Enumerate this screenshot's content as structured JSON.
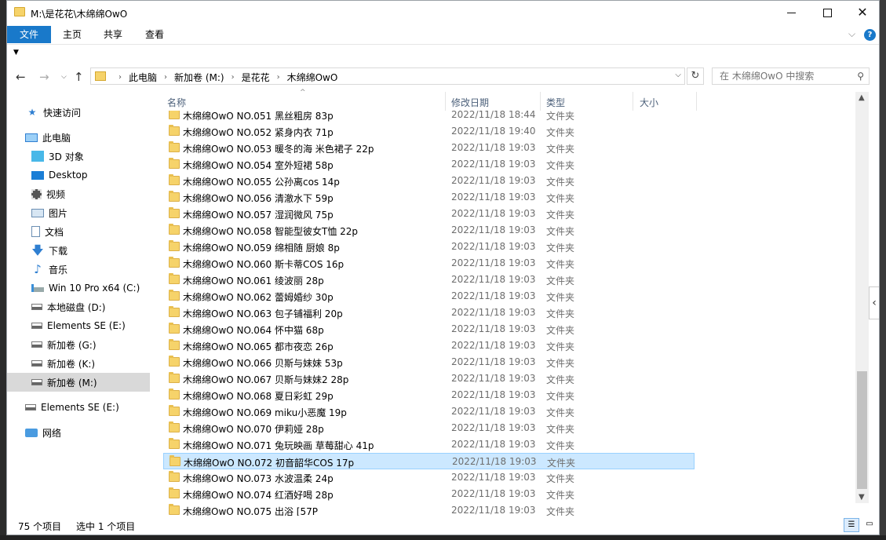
{
  "window": {
    "title": "M:\\是花花\\木绵绵OwO"
  },
  "ribbon": {
    "tabs": [
      "文件",
      "主页",
      "共享",
      "查看"
    ]
  },
  "address": {
    "crumbs": [
      "此电脑",
      "新加卷 (M:)",
      "是花花",
      "木绵绵OwO"
    ],
    "search_placeholder": "在 木绵绵OwO 中搜索"
  },
  "nav": {
    "items": [
      {
        "label": "快速访问",
        "icon": "star-icon"
      },
      {
        "label": "此电脑",
        "icon": "computer-icon"
      },
      {
        "label": "3D 对象",
        "icon": "3d-objects-icon"
      },
      {
        "label": "Desktop",
        "icon": "desktop-icon"
      },
      {
        "label": "视频",
        "icon": "video-icon"
      },
      {
        "label": "图片",
        "icon": "pictures-icon"
      },
      {
        "label": "文档",
        "icon": "documents-icon"
      },
      {
        "label": "下载",
        "icon": "download-icon"
      },
      {
        "label": "音乐",
        "icon": "music-icon"
      },
      {
        "label": "Win 10 Pro x64 (C:)",
        "icon": "windows-drive-icon"
      },
      {
        "label": "本地磁盘 (D:)",
        "icon": "drive-icon"
      },
      {
        "label": "Elements SE (E:)",
        "icon": "drive-icon"
      },
      {
        "label": "新加卷 (G:)",
        "icon": "drive-icon"
      },
      {
        "label": "新加卷 (K:)",
        "icon": "drive-icon"
      },
      {
        "label": "新加卷 (M:)",
        "icon": "drive-icon"
      },
      {
        "label": "Elements SE (E:)",
        "icon": "drive-icon"
      },
      {
        "label": "网络",
        "icon": "network-icon"
      }
    ],
    "selected_label": "新加卷 (M:)"
  },
  "columns": {
    "name": "名称",
    "date": "修改日期",
    "type": "类型",
    "size": "大小"
  },
  "files": [
    {
      "name": "木绵绵OwO NO.051 黑丝粗房 83p",
      "date": "2022/11/18 18:44",
      "type": "文件夹"
    },
    {
      "name": "木绵绵OwO NO.052 紧身内衣 71p",
      "date": "2022/11/18 19:40",
      "type": "文件夹"
    },
    {
      "name": "木绵绵OwO NO.053 暖冬的海 米色裙子 22p",
      "date": "2022/11/18 19:03",
      "type": "文件夹"
    },
    {
      "name": "木绵绵OwO NO.054 室外短裙 58p",
      "date": "2022/11/18 19:03",
      "type": "文件夹"
    },
    {
      "name": "木绵绵OwO NO.055 公孙离cos 14p",
      "date": "2022/11/18 19:03",
      "type": "文件夹"
    },
    {
      "name": "木绵绵OwO NO.056 清澈水下 59p",
      "date": "2022/11/18 19:03",
      "type": "文件夹"
    },
    {
      "name": "木绵绵OwO NO.057 湿润微风 75p",
      "date": "2022/11/18 19:03",
      "type": "文件夹"
    },
    {
      "name": "木绵绵OwO NO.058 智能型彼女T恤 22p",
      "date": "2022/11/18 19:03",
      "type": "文件夹"
    },
    {
      "name": "木绵绵OwO NO.059 绵相随 厨娘 8p",
      "date": "2022/11/18 19:03",
      "type": "文件夹"
    },
    {
      "name": "木绵绵OwO NO.060 斯卡蒂COS 16p",
      "date": "2022/11/18 19:03",
      "type": "文件夹"
    },
    {
      "name": "木绵绵OwO NO.061 绫波丽 28p",
      "date": "2022/11/18 19:03",
      "type": "文件夹"
    },
    {
      "name": "木绵绵OwO NO.062 蕾姆婚纱 30p",
      "date": "2022/11/18 19:03",
      "type": "文件夹"
    },
    {
      "name": "木绵绵OwO NO.063 包子铺福利 20p",
      "date": "2022/11/18 19:03",
      "type": "文件夹"
    },
    {
      "name": "木绵绵OwO NO.064 怀中猫 68p",
      "date": "2022/11/18 19:03",
      "type": "文件夹"
    },
    {
      "name": "木绵绵OwO NO.065 都市夜恋 26p",
      "date": "2022/11/18 19:03",
      "type": "文件夹"
    },
    {
      "name": "木绵绵OwO NO.066 贝斯与妹妹 53p",
      "date": "2022/11/18 19:03",
      "type": "文件夹"
    },
    {
      "name": "木绵绵OwO NO.067 贝斯与妹妹2 28p",
      "date": "2022/11/18 19:03",
      "type": "文件夹"
    },
    {
      "name": "木绵绵OwO NO.068 夏日彩虹 29p",
      "date": "2022/11/18 19:03",
      "type": "文件夹"
    },
    {
      "name": "木绵绵OwO NO.069 miku小恶魔 19p",
      "date": "2022/11/18 19:03",
      "type": "文件夹"
    },
    {
      "name": "木绵绵OwO NO.070 伊莉娅 28p",
      "date": "2022/11/18 19:03",
      "type": "文件夹"
    },
    {
      "name": "木绵绵OwO NO.071 兔玩映画 草莓甜心 41p",
      "date": "2022/11/18 19:03",
      "type": "文件夹"
    },
    {
      "name": "木绵绵OwO NO.072 初音韶华COS 17p",
      "date": "2022/11/18 19:03",
      "type": "文件夹",
      "selected": true
    },
    {
      "name": "木绵绵OwO NO.073 水波温柔 24p",
      "date": "2022/11/18 19:03",
      "type": "文件夹"
    },
    {
      "name": "木绵绵OwO NO.074 红酒好喝 28p",
      "date": "2022/11/18 19:03",
      "type": "文件夹"
    },
    {
      "name": "木绵绵OwO NO.075 出浴 [57P",
      "date": "2022/11/18 19:03",
      "type": "文件夹"
    }
  ],
  "status": {
    "count": "75 个项目",
    "selected": "选中 1 个项目"
  },
  "colors": {
    "accent": "#1979ca",
    "selection": "#cce8ff",
    "folder": "#f6d36a"
  }
}
